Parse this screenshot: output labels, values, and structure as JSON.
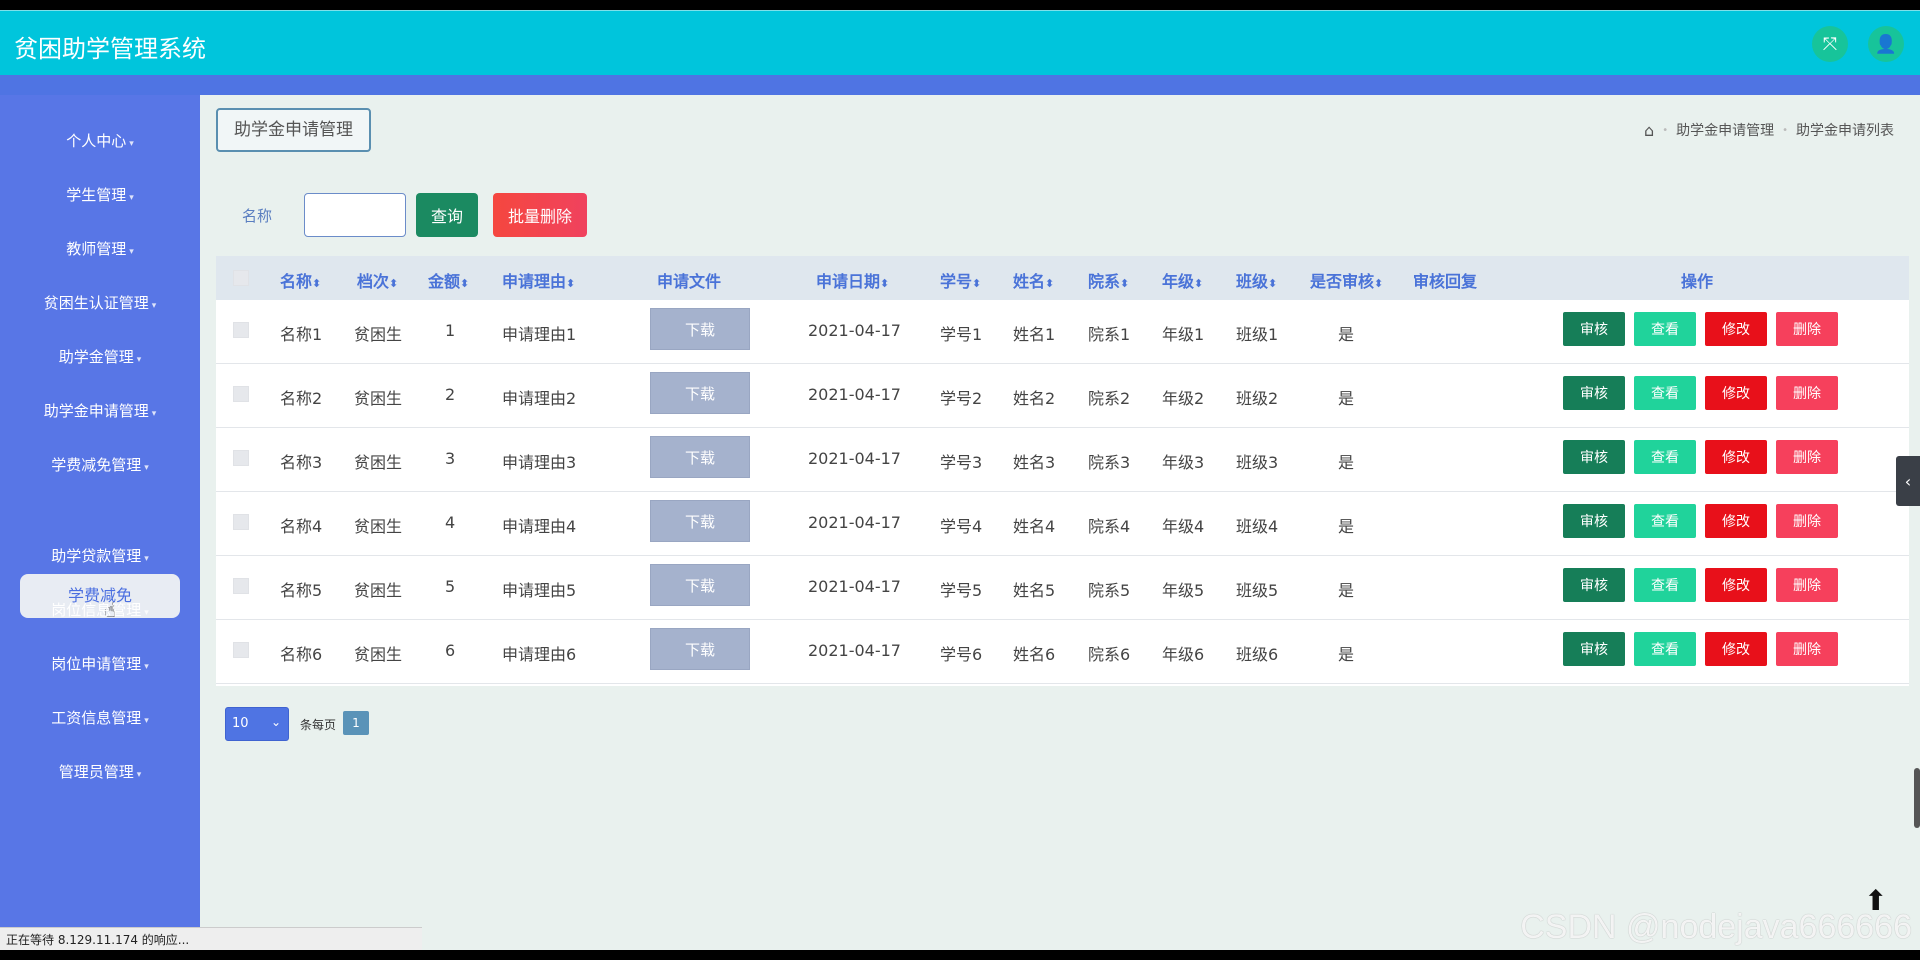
{
  "header": {
    "title": "贫困助学管理系统",
    "fullscreen_icon": "⤧",
    "user_icon": "👤"
  },
  "sidebar": {
    "items": [
      {
        "label": "个人中心"
      },
      {
        "label": "学生管理"
      },
      {
        "label": "教师管理"
      },
      {
        "label": "贫困生认证管理"
      },
      {
        "label": "助学金管理"
      },
      {
        "label": "助学金申请管理"
      },
      {
        "label": "学费减免管理"
      },
      {
        "label": "助学贷款管理"
      },
      {
        "label": "岗位信息管理"
      },
      {
        "label": "岗位申请管理"
      },
      {
        "label": "工资信息管理"
      },
      {
        "label": "管理员管理"
      }
    ],
    "active_sub": "学费减免",
    "status": "正在等待 8.129.11.174 的响应..."
  },
  "page": {
    "tag_title": "助学金申请管理",
    "breadcrumb": [
      "助学金申请管理",
      "助学金申请列表"
    ]
  },
  "search": {
    "label": "名称",
    "value": "",
    "query_label": "查询",
    "batch_delete_label": "批量删除"
  },
  "table": {
    "headers": [
      "名称",
      "档次",
      "金额",
      "申请理由",
      "申请文件",
      "申请日期",
      "学号",
      "姓名",
      "院系",
      "年级",
      "班级",
      "是否审核",
      "审核回复",
      "操作"
    ],
    "download_label": "下载",
    "actions": {
      "audit": "审核",
      "view": "查看",
      "edit": "修改",
      "delete": "删除"
    },
    "rows": [
      {
        "name": "名称1",
        "level": "贫困生",
        "amount": "1",
        "reason": "申请理由1",
        "date": "2021-04-17",
        "sid": "学号1",
        "sname": "姓名1",
        "dept": "院系1",
        "grade": "年级1",
        "class": "班级1",
        "audited": "是",
        "reply": ""
      },
      {
        "name": "名称2",
        "level": "贫困生",
        "amount": "2",
        "reason": "申请理由2",
        "date": "2021-04-17",
        "sid": "学号2",
        "sname": "姓名2",
        "dept": "院系2",
        "grade": "年级2",
        "class": "班级2",
        "audited": "是",
        "reply": ""
      },
      {
        "name": "名称3",
        "level": "贫困生",
        "amount": "3",
        "reason": "申请理由3",
        "date": "2021-04-17",
        "sid": "学号3",
        "sname": "姓名3",
        "dept": "院系3",
        "grade": "年级3",
        "class": "班级3",
        "audited": "是",
        "reply": ""
      },
      {
        "name": "名称4",
        "level": "贫困生",
        "amount": "4",
        "reason": "申请理由4",
        "date": "2021-04-17",
        "sid": "学号4",
        "sname": "姓名4",
        "dept": "院系4",
        "grade": "年级4",
        "class": "班级4",
        "audited": "是",
        "reply": ""
      },
      {
        "name": "名称5",
        "level": "贫困生",
        "amount": "5",
        "reason": "申请理由5",
        "date": "2021-04-17",
        "sid": "学号5",
        "sname": "姓名5",
        "dept": "院系5",
        "grade": "年级5",
        "class": "班级5",
        "audited": "是",
        "reply": ""
      },
      {
        "name": "名称6",
        "level": "贫困生",
        "amount": "6",
        "reason": "申请理由6",
        "date": "2021-04-17",
        "sid": "学号6",
        "sname": "姓名6",
        "dept": "院系6",
        "grade": "年级6",
        "class": "班级6",
        "audited": "是",
        "reply": ""
      }
    ]
  },
  "pagination": {
    "page_size": "10",
    "per_page_label": "条每页",
    "current_page": "1"
  },
  "watermark": "CSDN @nodejava666666"
}
